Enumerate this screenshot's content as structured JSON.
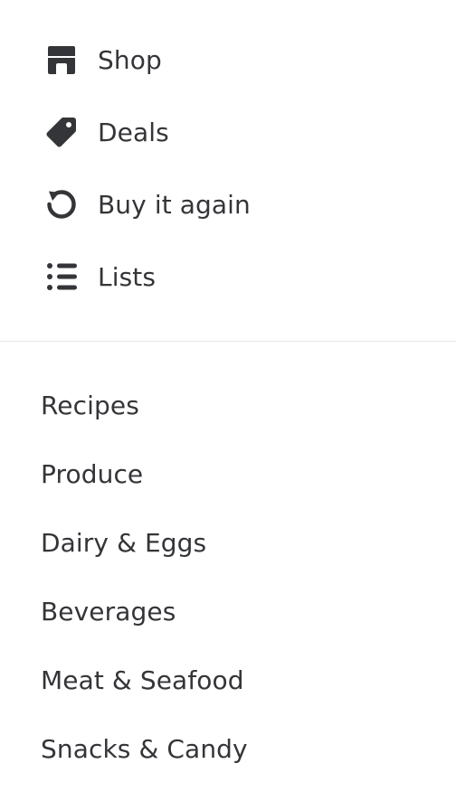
{
  "nav": {
    "items": [
      {
        "label": "Shop",
        "icon": "storefront-icon"
      },
      {
        "label": "Deals",
        "icon": "tag-icon"
      },
      {
        "label": "Buy it again",
        "icon": "refresh-icon"
      },
      {
        "label": "Lists",
        "icon": "list-icon"
      }
    ]
  },
  "categories": {
    "items": [
      {
        "label": "Recipes"
      },
      {
        "label": "Produce"
      },
      {
        "label": "Dairy & Eggs"
      },
      {
        "label": "Beverages"
      },
      {
        "label": "Meat & Seafood"
      },
      {
        "label": "Snacks & Candy"
      }
    ]
  },
  "colors": {
    "text": "#343538",
    "divider": "#e8e9eb",
    "background": "#ffffff"
  }
}
